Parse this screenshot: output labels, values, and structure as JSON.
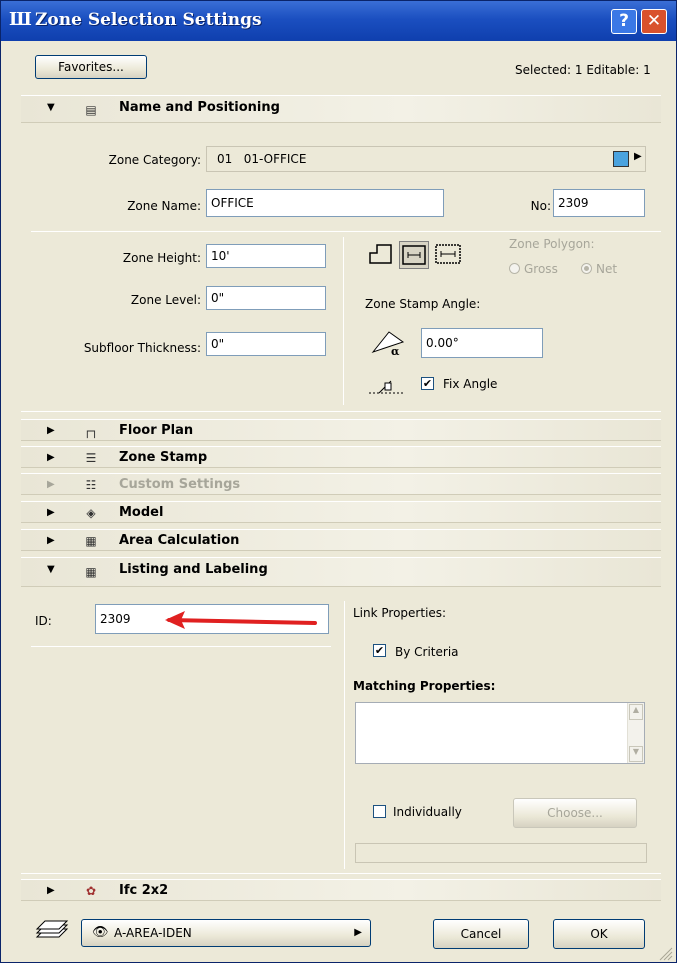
{
  "window": {
    "title": "Zone Selection Settings",
    "help": "?",
    "close": "✕"
  },
  "header": {
    "favorites_label": "Favorites...",
    "selection_status": "Selected: 1 Editable: 1"
  },
  "name_positioning": {
    "title": "Name and Positioning",
    "zone_category_label": "Zone Category:",
    "zone_category_value": "01   01-OFFICE",
    "category_color": "#4aa3df",
    "zone_name_label": "Zone Name:",
    "zone_name_value": "OFFICE",
    "no_label": "No:",
    "no_value": "2309",
    "zone_height_label": "Zone Height:",
    "zone_height_value": "10'",
    "zone_level_label": "Zone Level:",
    "zone_level_value": "0\"",
    "subfloor_label": "Subfloor Thickness:",
    "subfloor_value": "0\"",
    "zone_polygon_label": "Zone Polygon:",
    "gross_label": "Gross",
    "net_label": "Net",
    "stamp_angle_label": "Zone Stamp Angle:",
    "stamp_angle_value": "0.00°",
    "fix_angle_label": "Fix Angle",
    "fix_angle_checked": true
  },
  "sections": {
    "floor_plan": "Floor Plan",
    "zone_stamp": "Zone Stamp",
    "custom_settings": "Custom Settings",
    "model": "Model",
    "area_calculation": "Area Calculation",
    "listing_labeling": "Listing and Labeling",
    "ifc": "Ifc 2x2"
  },
  "listing": {
    "id_label": "ID:",
    "id_value": "2309",
    "link_properties_label": "Link Properties:",
    "by_criteria_label": "By Criteria",
    "by_criteria_checked": true,
    "matching_properties_label": "Matching Properties:",
    "individually_label": "Individually",
    "individually_checked": false,
    "choose_label": "Choose...",
    "bottom_field_value": ""
  },
  "footer": {
    "layer_value": "A-AREA-IDEN",
    "cancel_label": "Cancel",
    "ok_label": "OK"
  },
  "colors": {
    "title_bar": "#1b4fc0",
    "annotation_arrow": "#e02020",
    "dialog_bg": "#ece9d8"
  }
}
